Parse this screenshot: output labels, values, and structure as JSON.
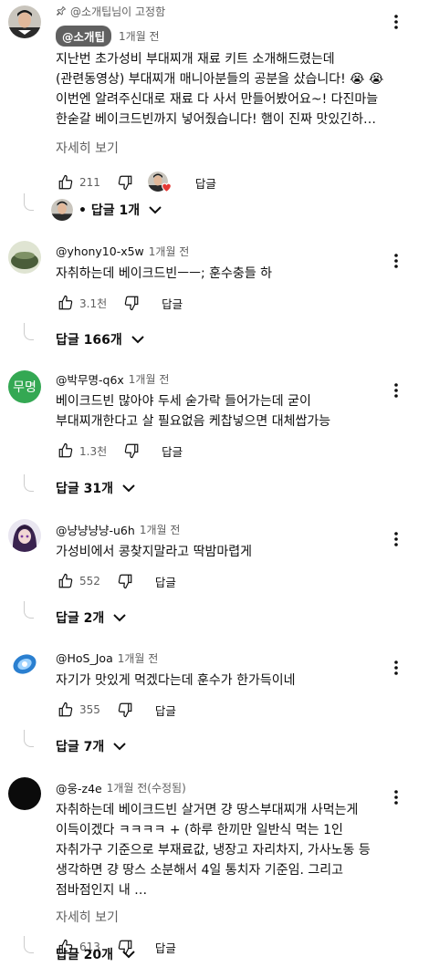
{
  "comments": [
    {
      "pinned_label": "@소개팁님이 고정함",
      "handle": "@소개팁",
      "time": "1개월 전",
      "text": "지난번 초가성비 부대찌개 재료 키트 소개해드렸는데 (관련동영상) 부대찌개 매니아분들의 공분을 샀습니다! 😭 😭 이번엔 알려주신대로 재료 다 사서 만들어봤어요~! 다진마늘 한숟갈 베이크드빈까지 넣어줬습니다! 햄이 진짜 맛있긴하…",
      "more": "자세히 보기",
      "likes": "211",
      "reply_label": "답글",
      "replies": "• 답글 1개"
    },
    {
      "handle": "@yhony10-x5w",
      "time": "1개월 전",
      "text": "자취하는데 베이크드빈ㅡㅡ; 훈수충들 하",
      "likes": "3.1천",
      "reply_label": "답글",
      "replies": "답글 166개"
    },
    {
      "handle": "@박무명-q6x",
      "time": "1개월 전",
      "avatar_text": "무명",
      "text": "베이크드빈 많아야 두세 숟가락 들어가는데 굳이 부대찌개한다고 살 필요없음 케찹넣으면 대체쌉가능",
      "likes": "1.3천",
      "reply_label": "답글",
      "replies": "답글 31개"
    },
    {
      "handle": "@냥냥냥냥-u6h",
      "time": "1개월 전",
      "text": "가성비에서 콩찾지말라고 딱밤마렵게",
      "likes": "552",
      "reply_label": "답글",
      "replies": "답글 2개"
    },
    {
      "handle": "@HoS_Joa",
      "time": "1개월 전",
      "text": "자기가 맛있게 먹겠다는데 훈수가 한가득이네",
      "likes": "355",
      "reply_label": "답글",
      "replies": "답글 7개"
    },
    {
      "handle": "@웅-z4e",
      "time": "1개월 전(수정됨)",
      "text": "자취하는데 베이크드빈 살거면 걍 땅스부대찌개 사먹는게 이득이겠다 ㅋㅋㅋㅋ + (하루 한끼만 일반식 먹는 1인 자취가구 기준으로 부재료값, 냉장고 자리차지, 가사노동 등 생각하면 걍 땅스 소분해서 4일 통치자 기준임. 그리고 점바점인지 내 …",
      "more": "자세히 보기",
      "likes": "613",
      "reply_label": "답글",
      "replies": "답글 20개"
    }
  ],
  "colors": {
    "secondary_text": "#606060",
    "avatar_green": "#34a853",
    "heart_red": "#e53935"
  },
  "icons": [
    "pin-icon",
    "like-icon",
    "dislike-icon",
    "more-vert-icon",
    "chevron-down-icon",
    "heart-icon"
  ]
}
